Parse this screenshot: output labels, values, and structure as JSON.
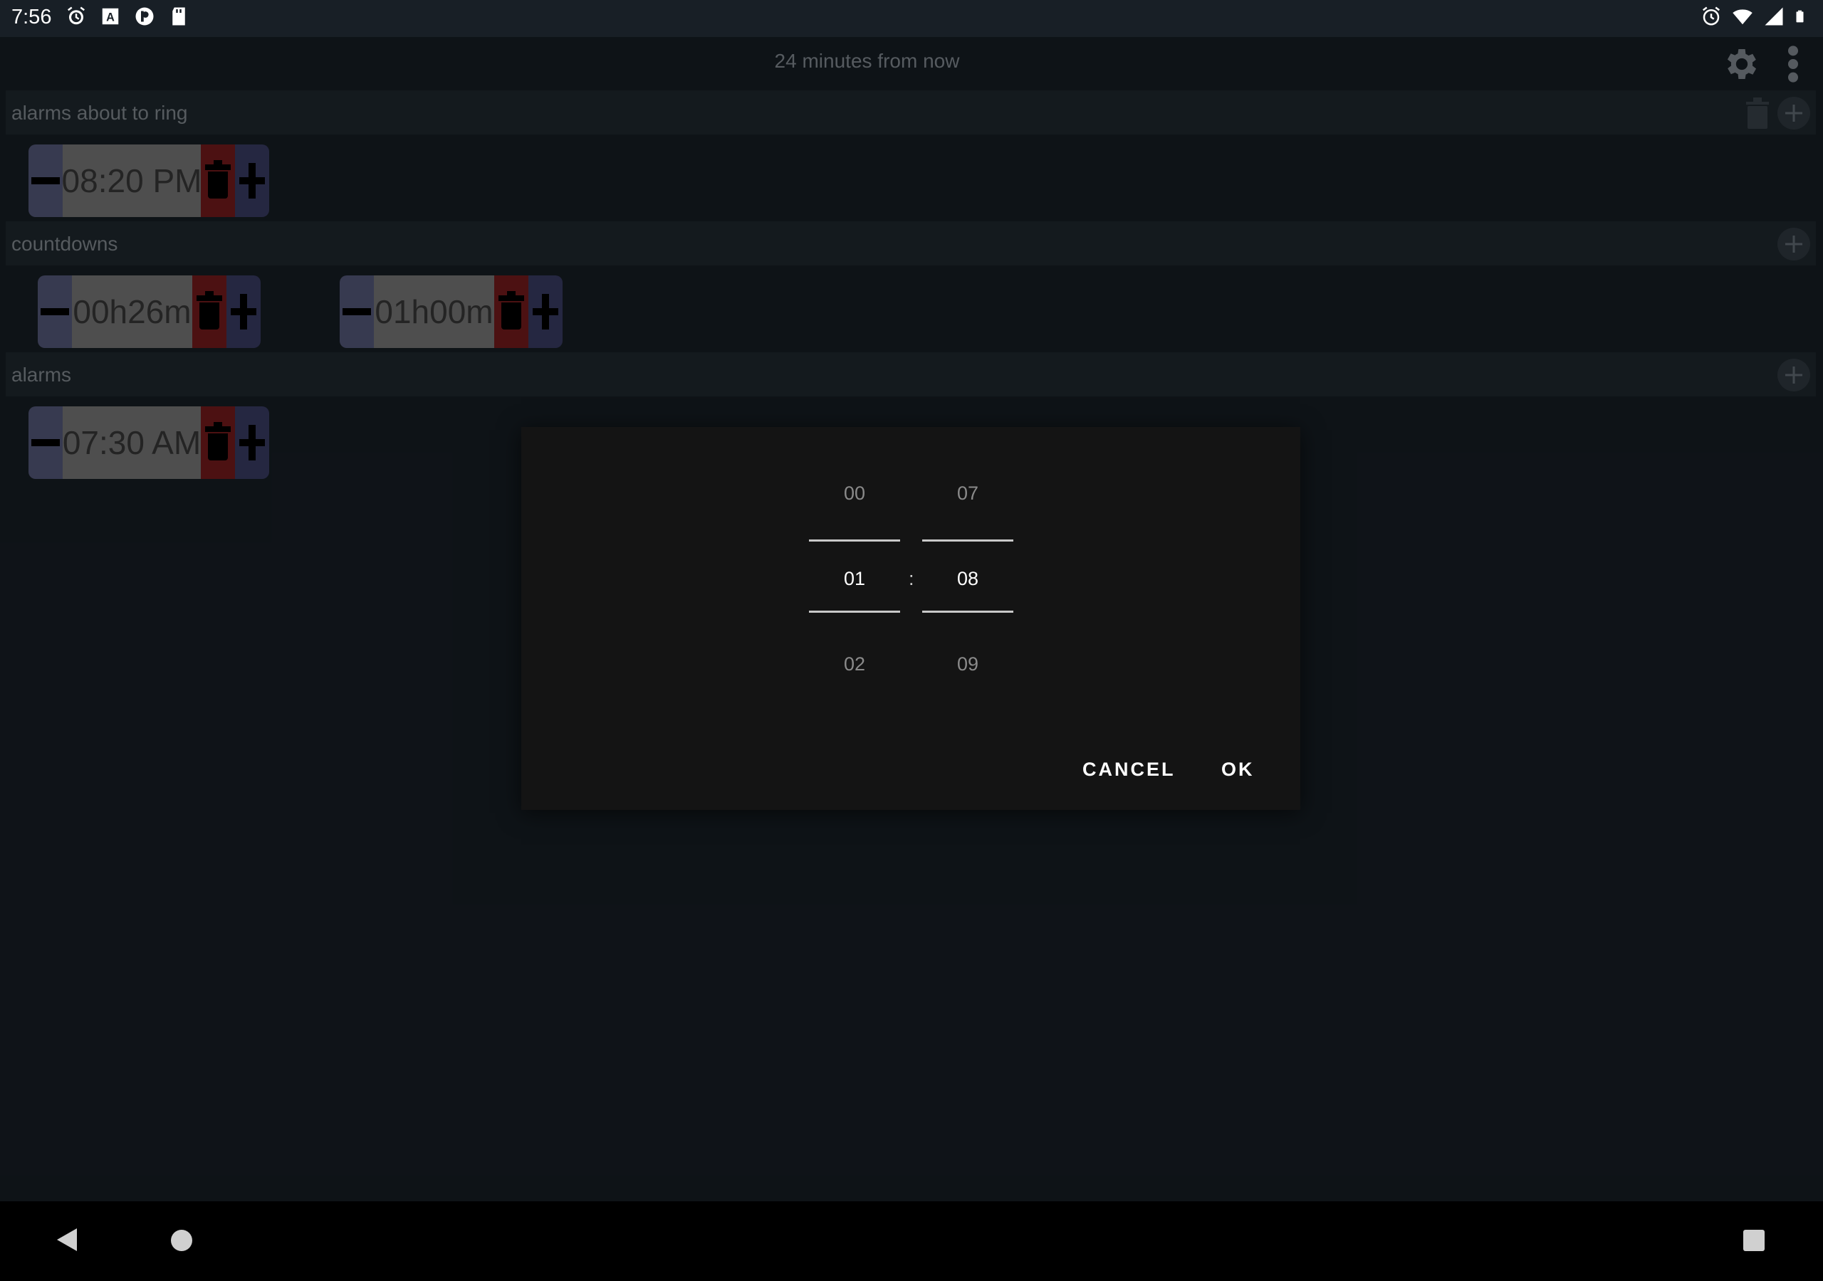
{
  "status_bar": {
    "time": "7:56",
    "left_icons": [
      "alarm-icon",
      "a-badge-icon",
      "p-badge-icon",
      "sd-card-icon"
    ],
    "right_icons": [
      "alarm-icon",
      "wifi-icon",
      "signal-icon",
      "battery-icon"
    ]
  },
  "header": {
    "title": "24 minutes from now"
  },
  "sections": {
    "about_to_ring": {
      "label": "alarms about to ring",
      "items": [
        {
          "time": "08:20 PM"
        }
      ]
    },
    "countdowns": {
      "label": "countdowns",
      "items": [
        {
          "time": "00h26m"
        },
        {
          "time": "01h00m"
        }
      ]
    },
    "alarms": {
      "label": "alarms",
      "items": [
        {
          "time": "07:30 AM"
        }
      ]
    }
  },
  "dialog": {
    "hours": {
      "above": "00",
      "selected": "01",
      "below": "02"
    },
    "minutes": {
      "above": "07",
      "selected": "08",
      "below": "09"
    },
    "separator": ":",
    "cancel_label": "CANCEL",
    "ok_label": "OK"
  },
  "colors": {
    "background": "#181f26",
    "section_bar": "#212a31",
    "chip_minus": "#5a5e82",
    "chip_delete": "#7b1c1e",
    "chip_add": "#3c3f69",
    "dialog": "#141414"
  }
}
